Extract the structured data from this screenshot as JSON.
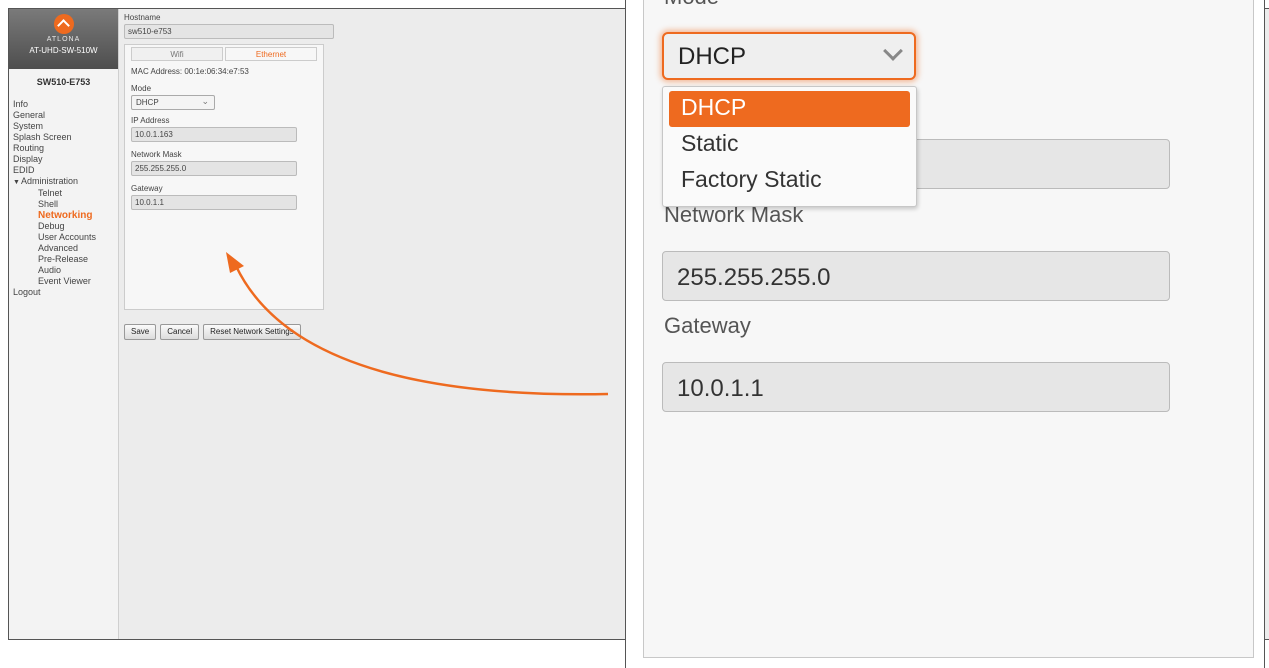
{
  "brand": {
    "name": "ATLONA",
    "model": "AT-UHD-SW-510W"
  },
  "device_name": "SW510-E753",
  "nav": {
    "items": [
      {
        "label": "Info"
      },
      {
        "label": "General"
      },
      {
        "label": "System"
      },
      {
        "label": "Splash Screen"
      },
      {
        "label": "Routing"
      },
      {
        "label": "Display"
      },
      {
        "label": "EDID"
      },
      {
        "label": "Administration",
        "expanded": true
      },
      {
        "label": "Telnet"
      },
      {
        "label": "Shell"
      },
      {
        "label": "Networking",
        "active": true
      },
      {
        "label": "Debug"
      },
      {
        "label": "User Accounts"
      },
      {
        "label": "Advanced"
      },
      {
        "label": "Pre-Release"
      },
      {
        "label": "Audio"
      },
      {
        "label": "Event Viewer"
      },
      {
        "label": "Logout"
      }
    ]
  },
  "form": {
    "hostname_label": "Hostname",
    "hostname_value": "sw510-e753",
    "tabs": [
      {
        "label": "Wifi",
        "active": false
      },
      {
        "label": "Ethernet",
        "active": true
      }
    ],
    "mac_address": "MAC Address: 00:1e:06:34:e7:53",
    "mode_label": "Mode",
    "mode_value": "DHCP",
    "ip_label": "IP Address",
    "ip_value": "10.0.1.163",
    "mask_label": "Network Mask",
    "mask_value": "255.255.255.0",
    "gateway_label": "Gateway",
    "gateway_value": "10.0.1.1"
  },
  "buttons": {
    "save": "Save",
    "cancel": "Cancel",
    "reset": "Reset Network Settings"
  },
  "zoom": {
    "mode_label": "Mode",
    "mode_value": "DHCP",
    "options": [
      "DHCP",
      "Static",
      "Factory Static"
    ],
    "selected_option": "DHCP",
    "mask_label": "Network Mask",
    "mask_value": "255.255.255.0",
    "gateway_label": "Gateway",
    "gateway_value": "10.0.1.1"
  },
  "colors": {
    "accent": "#ee6a1f",
    "sidebar_bg": "#f3f3f3",
    "page_bg": "#ececec"
  },
  "icons": {
    "logo": "atlona-logo-icon",
    "expand": "caret-down-icon",
    "select": "chevron-down-icon"
  }
}
